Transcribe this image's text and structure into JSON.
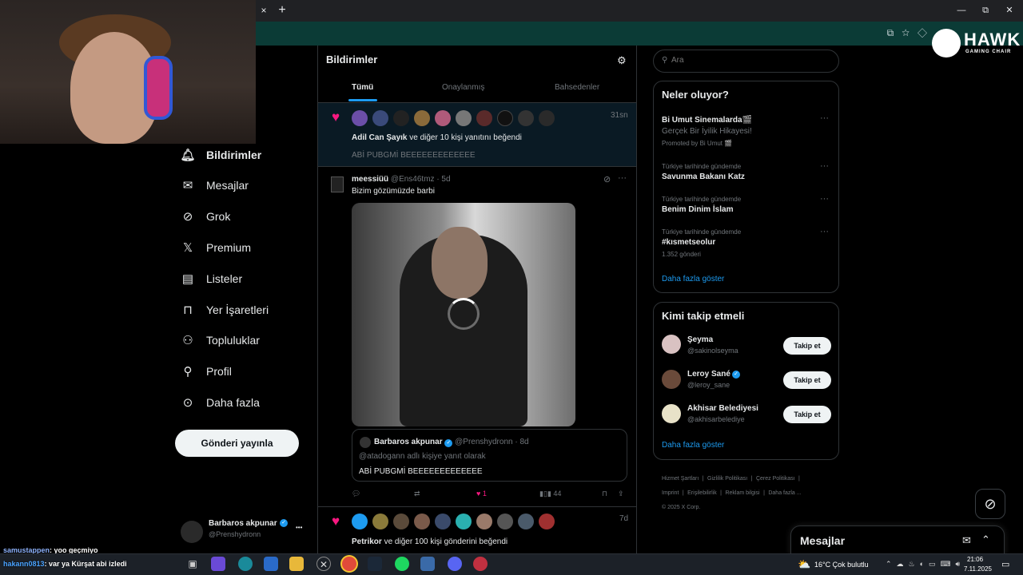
{
  "browser": {
    "tab_close": "×",
    "new_tab": "+",
    "window_controls": {
      "minimize": "—",
      "restore": "⧉",
      "close": "✕"
    }
  },
  "left_nav": {
    "items": [
      {
        "label": "Bildirimler",
        "icon": "bell-icon",
        "active": true
      },
      {
        "label": "Mesajlar",
        "icon": "mail-icon",
        "active": false
      },
      {
        "label": "Grok",
        "icon": "grok-icon",
        "active": false
      },
      {
        "label": "Premium",
        "icon": "x-logo-icon",
        "active": false
      },
      {
        "label": "Listeler",
        "icon": "list-icon",
        "active": false
      },
      {
        "label": "Yer İşaretleri",
        "icon": "bookmark-icon",
        "active": false
      },
      {
        "label": "Topluluklar",
        "icon": "people-icon",
        "active": false
      },
      {
        "label": "Profil",
        "icon": "person-icon",
        "active": false
      },
      {
        "label": "Daha fazla",
        "icon": "more-circle-icon",
        "active": false
      }
    ],
    "post_button": "Gönderi yayınla",
    "account": {
      "name": "Barbaros akpunar",
      "handle": "@Prenshydronn",
      "more": "•••"
    }
  },
  "notifications": {
    "title": "Bildirimler",
    "tabs": [
      "Tümü",
      "Onaylanmış",
      "Bahsedenler"
    ],
    "like_notif": {
      "time": "31sn",
      "text_bold": "Adil Can Şayık",
      "text_rest": " ve diğer 10 kişi yanıtını beğendi",
      "snippet": "ABİ PUBGMİ BEEEEEEEEEEEEE"
    },
    "reply": {
      "name": "meessiüü",
      "handle": "@Ens46tmz · 5d",
      "text": "Bizim gözümüzde barbi",
      "quote": {
        "name": "Barbaros akpunar",
        "handle": "@Prenshydronn · 8d",
        "context": "@atadogann adlı kişiye yanıt olarak",
        "text": "ABİ PUBGMİ BEEEEEEEEEEEEE"
      },
      "actions": {
        "likes": "1",
        "views": "44"
      }
    },
    "like_notif2": {
      "time": "7d",
      "text_bold": "Petrikor",
      "text_rest": " ve diğer 100 kişi gönderini beğendi"
    }
  },
  "right": {
    "search_placeholder": "Ara",
    "trends": {
      "title": "Neler oluyor?",
      "promoted": {
        "name": "Bi Umut Sinemalarda🎬",
        "sub": "Gerçek Bir İyilik Hikayesi!",
        "promo": "Promoted by Bi Umut 🎬"
      },
      "items": [
        {
          "context": "Türkiye tarihinde gündemde",
          "name": "Savunma Bakanı Katz",
          "count": ""
        },
        {
          "context": "Türkiye tarihinde gündemde",
          "name": "Benim Dinim İslam",
          "count": ""
        },
        {
          "context": "Türkiye tarihinde gündemde",
          "name": "#kısmetseolur",
          "count": "1.352 gönderi"
        }
      ],
      "more": "Daha fazla göster"
    },
    "who_to_follow": {
      "title": "Kimi takip etmeli",
      "users": [
        {
          "name": "Şeyma",
          "handle": "@sakinolseyma",
          "verified": false,
          "button": "Takip et"
        },
        {
          "name": "Leroy Sané",
          "handle": "@leroy_sane",
          "verified": true,
          "button": "Takip et"
        },
        {
          "name": "Akhisar Belediyesi",
          "handle": "@akhisarbelediye",
          "verified": false,
          "button": "Takip et"
        }
      ],
      "more": "Daha fazla göster"
    },
    "footer": [
      "Hizmet Şartları",
      "Gizlilik Politikası",
      "Çerez Politikası",
      "Imprint",
      "Erişilebilirlik",
      "Reklam bilgisi",
      "Daha fazla ...",
      "© 2025 X Corp."
    ],
    "dm_drawer": "Mesajlar"
  },
  "overlay": {
    "logo_text": "HAWK",
    "logo_sub": "GAMING CHAIR",
    "chat": [
      {
        "user": "samustappen",
        "msg": ": yoo geçmiyo",
        "color": "#8fb4ff"
      },
      {
        "user": "hakann0813",
        "msg": ": var ya Kürşat abi izledi",
        "color": "#4aa3ff"
      }
    ]
  },
  "taskbar": {
    "weather": "16°C  Çok bulutlu",
    "time": "21:06",
    "date": "7.11.2025"
  },
  "colors": {
    "accent": "#1d9bf0",
    "like": "#f91880",
    "background": "#000000",
    "addressbar": "#0b3b36"
  }
}
